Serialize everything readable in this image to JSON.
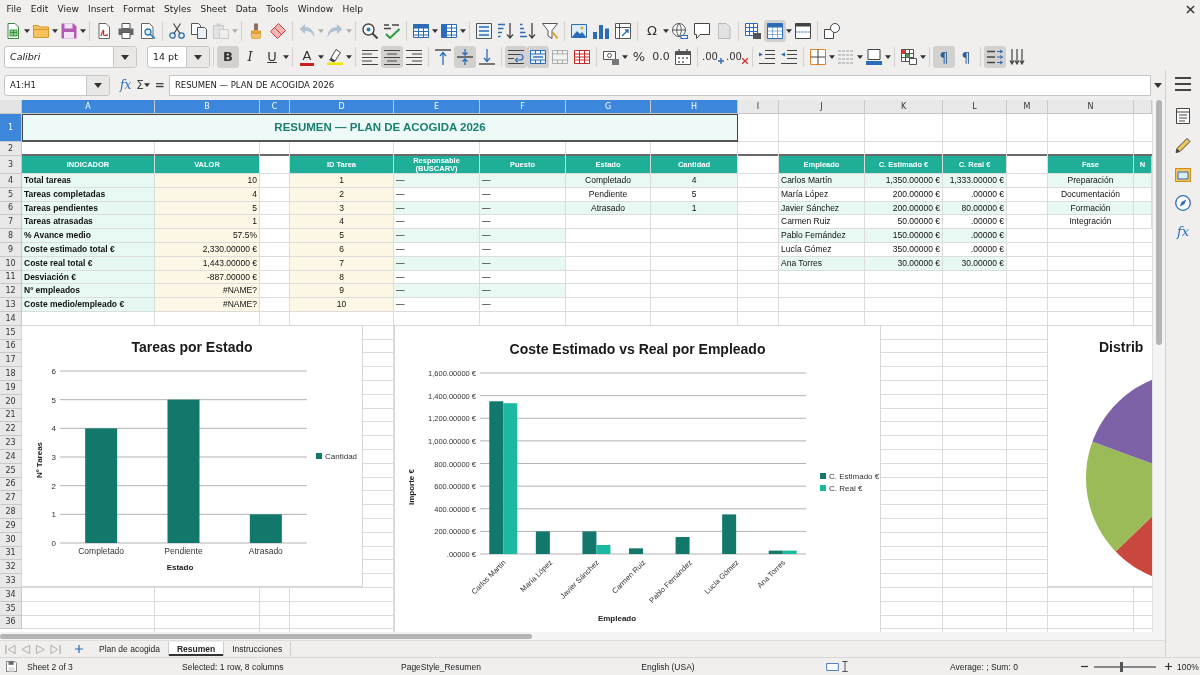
{
  "menu": [
    "File",
    "Edit",
    "View",
    "Insert",
    "Format",
    "Styles",
    "Sheet",
    "Data",
    "Tools",
    "Window",
    "Help"
  ],
  "standard_toolbar": {
    "paste_disabled": true,
    "undo_disabled": true,
    "redo_disabled": true,
    "special_character": "Ω",
    "freeze_on": true
  },
  "formatting_toolbar": {
    "font_name": "Calibri",
    "font_size": "14 pt",
    "text_style": [
      {
        "label": "B",
        "on": true
      },
      {
        "label": "I",
        "on": false
      },
      {
        "label": "U",
        "on": false
      }
    ],
    "font_color": "A",
    "horizontal_align": [
      {
        "selected": false
      },
      {
        "selected": true
      },
      {
        "selected": false
      }
    ],
    "vertical_align": [
      {
        "selected": false
      },
      {
        "selected": true
      },
      {
        "selected": false
      }
    ],
    "wrap_text_on": true,
    "merge_center_on": true,
    "percent": "%",
    "standard_format": "0.0",
    "add_decimal": ".00",
    "delete_decimal": ".00",
    "direction": [
      {
        "label": "¶",
        "selected": true
      },
      {
        "label": "¶",
        "selected": false
      }
    ],
    "stacked_on": true
  },
  "formula_bar": {
    "name_box": "A1:H1",
    "function_wizard": "fx",
    "sum": "Σ",
    "equals": "=",
    "content": "RESUMEN — PLAN DE ACOGIDA 2026"
  },
  "sidebar": {
    "functions": "fx"
  },
  "sheet": {
    "columns": [
      {
        "label": "A",
        "selected": true
      },
      {
        "label": "B",
        "selected": true
      },
      {
        "label": "C",
        "selected": true
      },
      {
        "label": "D",
        "selected": true
      },
      {
        "label": "E",
        "selected": true
      },
      {
        "label": "F",
        "selected": true
      },
      {
        "label": "G",
        "selected": true
      },
      {
        "label": "H",
        "selected": true
      },
      {
        "label": "I",
        "selected": false
      },
      {
        "label": "J",
        "selected": false
      },
      {
        "label": "K",
        "selected": false
      },
      {
        "label": "L",
        "selected": false
      },
      {
        "label": "M",
        "selected": false
      },
      {
        "label": "N",
        "selected": false
      }
    ],
    "rows": [
      {
        "label": "1",
        "selected": true
      },
      {
        "label": "2",
        "selected": false
      },
      {
        "label": "3",
        "selected": false
      },
      {
        "label": "4",
        "selected": false
      },
      {
        "label": "5",
        "selected": false
      },
      {
        "label": "6",
        "selected": false
      },
      {
        "label": "7",
        "selected": false
      },
      {
        "label": "8",
        "selected": false
      },
      {
        "label": "9",
        "selected": false
      },
      {
        "label": "10",
        "selected": false
      },
      {
        "label": "11",
        "selected": false
      },
      {
        "label": "12",
        "selected": false
      },
      {
        "label": "13",
        "selected": false
      },
      {
        "label": "14",
        "selected": false
      },
      {
        "label": "15",
        "selected": false
      },
      {
        "label": "16",
        "selected": false
      },
      {
        "label": "17",
        "selected": false
      },
      {
        "label": "18",
        "selected": false
      },
      {
        "label": "19",
        "selected": false
      },
      {
        "label": "20",
        "selected": false
      },
      {
        "label": "21",
        "selected": false
      },
      {
        "label": "22",
        "selected": false
      },
      {
        "label": "23",
        "selected": false
      },
      {
        "label": "24",
        "selected": false
      },
      {
        "label": "25",
        "selected": false
      },
      {
        "label": "26",
        "selected": false
      },
      {
        "label": "27",
        "selected": false
      },
      {
        "label": "28",
        "selected": false
      },
      {
        "label": "29",
        "selected": false
      },
      {
        "label": "30",
        "selected": false
      },
      {
        "label": "31",
        "selected": false
      },
      {
        "label": "32",
        "selected": false
      },
      {
        "label": "33",
        "selected": false
      },
      {
        "label": "34",
        "selected": false
      },
      {
        "label": "35",
        "selected": false
      },
      {
        "label": "36",
        "selected": false
      }
    ],
    "title": "RESUMEN — PLAN DE ACOGIDA 2026",
    "tables": [
      {
        "headers": [
          "INDICADOR",
          "VALOR"
        ],
        "rows": [
          [
            "Total tareas",
            "10"
          ],
          [
            "Tareas completadas",
            "4"
          ],
          [
            "Tareas pendientes",
            "5"
          ],
          [
            "Tareas atrasadas",
            "1"
          ],
          [
            "% Avance medio",
            "57.5%"
          ],
          [
            "Coste estimado total €",
            "2,330.00000 €"
          ],
          [
            "Coste real total €",
            "1,443.00000 €"
          ],
          [
            "Desviación €",
            "-887.00000 €"
          ],
          [
            "Nº empleados",
            "#NAME?"
          ],
          [
            "Coste medio/empleado €",
            "#NAME?"
          ]
        ]
      },
      {
        "headers": [
          "ID Tarea",
          "Responsable (BUSCARV)",
          "Puesto"
        ],
        "rows": [
          [
            "1",
            "—",
            "—"
          ],
          [
            "2",
            "—",
            "—"
          ],
          [
            "3",
            "—",
            "—"
          ],
          [
            "4",
            "—",
            "—"
          ],
          [
            "5",
            "—",
            "—"
          ],
          [
            "6",
            "—",
            "—"
          ],
          [
            "7",
            "—",
            "—"
          ],
          [
            "8",
            "—",
            "—"
          ],
          [
            "9",
            "—",
            "—"
          ],
          [
            "10",
            "—",
            "—"
          ]
        ]
      },
      {
        "headers": [
          "Estado",
          "Cantidad"
        ],
        "rows": [
          [
            "Completado",
            "4"
          ],
          [
            "Pendiente",
            "5"
          ],
          [
            "Atrasado",
            "1"
          ]
        ]
      },
      {
        "headers": [
          "Empleado",
          "C. Estimado €",
          "C. Real €"
        ],
        "rows": [
          [
            "Carlos Martín",
            "1,350.00000 €",
            "1,333.00000 €"
          ],
          [
            "María López",
            "200.00000 €",
            ".00000 €"
          ],
          [
            "Javier Sánchez",
            "200.00000 €",
            "80.00000 €"
          ],
          [
            "Carmen Ruiz",
            "50.00000 €",
            ".00000 €"
          ],
          [
            "Pablo Fernández",
            "150.00000 €",
            ".00000 €"
          ],
          [
            "Lucía Gómez",
            "350.00000 €",
            ".00000 €"
          ],
          [
            "Ana Torres",
            "30.00000 €",
            "30.00000 €"
          ]
        ]
      },
      {
        "headers": [
          "Fase",
          "N"
        ],
        "rows": [
          [
            "Preparación"
          ],
          [
            "Documentación"
          ],
          [
            "Formación"
          ],
          [
            "Integración"
          ]
        ]
      }
    ]
  },
  "charts": [
    {
      "chart_data": {
        "type": "bar",
        "title": "Tareas por Estado",
        "xlabel": "Estado",
        "ylabel": "Nº Tareas",
        "categories": [
          "Completado",
          "Pendiente",
          "Atrasado"
        ],
        "series": [
          {
            "name": "Cantidad",
            "color": "#13786c",
            "values": [
              4,
              5,
              1
            ]
          }
        ],
        "ylim": [
          0,
          6
        ],
        "yticks": [
          0,
          1,
          2,
          3,
          4,
          5,
          6
        ],
        "grid": true,
        "legend": true
      }
    },
    {
      "chart_data": {
        "type": "bar",
        "title": "Coste Estimado vs Real por Empleado",
        "xlabel": "Empleado",
        "ylabel": "Importe €",
        "categories": [
          "Carlos Martín",
          "María López",
          "Javier Sánchez",
          "Carmen Ruiz",
          "Pablo Fernández",
          "Lucía Gómez",
          "Ana Torres"
        ],
        "series": [
          {
            "name": "C. Estimado €",
            "color": "#13786c",
            "values": [
              1350,
              200,
              200,
              50,
              150,
              350,
              30
            ]
          },
          {
            "name": "C. Real €",
            "color": "#1bb9a1",
            "values": [
              1333,
              0,
              80,
              0,
              0,
              0,
              30
            ]
          }
        ],
        "ylim": [
          0,
          1600
        ],
        "yticks": [
          {
            "value": 0,
            "label": ".00000 €"
          },
          {
            "value": 200,
            "label": "200.00000 €"
          },
          {
            "value": 400,
            "label": "400.00000 €"
          },
          {
            "value": 600,
            "label": "600.00000 €"
          },
          {
            "value": 800,
            "label": "800.00000 €"
          },
          {
            "value": 1000,
            "label": "1,000.00000 €"
          },
          {
            "value": 1200,
            "label": "1,200.00000 €"
          },
          {
            "value": 1400,
            "label": "1,400.00000 €"
          },
          {
            "value": 1600,
            "label": "1,600.00000 €"
          }
        ],
        "grid": true,
        "legend": true
      }
    },
    {
      "title": "Distrib"
    }
  ],
  "sheet_tabs": [
    {
      "label": "Plan de acogida",
      "selected": false
    },
    {
      "label": "Resumen",
      "selected": true
    },
    {
      "label": "Instrucciones",
      "selected": false
    }
  ],
  "status_bar": {
    "sheet": "Sheet 2 of 3",
    "selection": "Selected: 1 row, 8 columns",
    "page_style": "PageStyle_Resumen",
    "language": "English (USA)",
    "summary": "Average: ; Sum: 0",
    "zoom_slider": {
      "level": 0.45
    },
    "zoom": "100%"
  }
}
